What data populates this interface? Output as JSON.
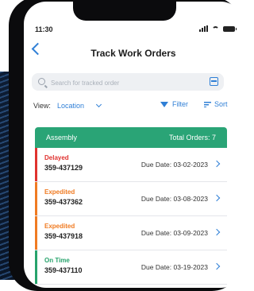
{
  "status_bar": {
    "time": "11:30"
  },
  "nav": {
    "title": "Track Work Orders"
  },
  "search": {
    "placeholder": "Search for tracked order",
    "value": ""
  },
  "toolbar": {
    "view_label": "View:",
    "view_value": "Location",
    "filter_label": "Filter",
    "sort_label": "Sort"
  },
  "table": {
    "header_left": "Assembly",
    "header_right": "Total Orders: 7",
    "rows": [
      {
        "status": "Delayed",
        "status_key": "delayed",
        "id": "359-437129",
        "due": "Due Date: 03-02-2023"
      },
      {
        "status": "Expedited",
        "status_key": "expedited",
        "id": "359-437362",
        "due": "Due Date: 03-08-2023"
      },
      {
        "status": "Expedited",
        "status_key": "expedited",
        "id": "359-437918",
        "due": "Due Date: 03-09-2023"
      },
      {
        "status": "On Time",
        "status_key": "ontime",
        "id": "359-437110",
        "due": "Due Date: 03-19-2023"
      }
    ]
  },
  "colors": {
    "accent": "#2f7fd6",
    "header_green": "#2aa476",
    "delayed": "#e0322f",
    "expedited": "#f07b22",
    "on_time": "#27a36c"
  }
}
